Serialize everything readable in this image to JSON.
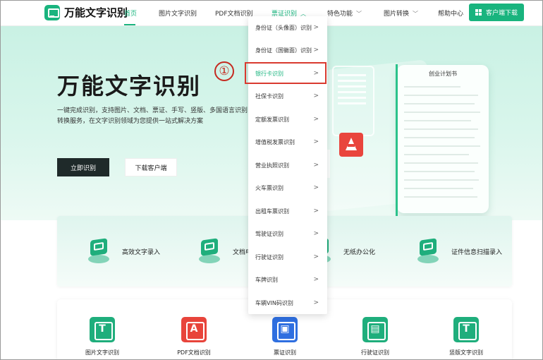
{
  "header": {
    "logo_text": "万能文字识别",
    "nav": [
      {
        "label": "首页"
      },
      {
        "label": "图片文字识别"
      },
      {
        "label": "PDF文档识别"
      },
      {
        "label": "票证识别"
      },
      {
        "label": "特色功能"
      },
      {
        "label": "图片转换"
      },
      {
        "label": "帮助中心"
      }
    ],
    "download_button": "客户端下载"
  },
  "hero": {
    "title": "万能文字识别",
    "description": "一键完成识别，支持图片、文档、票证、手写、竖版、多国语言识别转换服务，在文字识别领域为您提供一站式解决方案",
    "primary_button": "立即识别",
    "secondary_button": "下载客户端",
    "illustration_doc_title": "创业计划书"
  },
  "dropdown": {
    "items": [
      {
        "label": "身份证（头像面）识别"
      },
      {
        "label": "身份证（国徽面）识别"
      },
      {
        "label": "银行卡识别"
      },
      {
        "label": "社保卡识别"
      },
      {
        "label": "定额发票识别"
      },
      {
        "label": "增值税发票识别"
      },
      {
        "label": "营业执照识别"
      },
      {
        "label": "火车票识别"
      },
      {
        "label": "出租车票识别"
      },
      {
        "label": "驾驶证识别"
      },
      {
        "label": "行驶证识别"
      },
      {
        "label": "车牌识别"
      },
      {
        "label": "车辆VIN码识别"
      }
    ],
    "arrow": ">"
  },
  "annotation": {
    "number": "①"
  },
  "features": [
    {
      "label": "高效文字录入"
    },
    {
      "label": "文档电"
    },
    {
      "label": "无纸办公化"
    },
    {
      "label": "证件信息扫描录入"
    }
  ],
  "tools": [
    {
      "label": "图片文字识别",
      "glyph": "T",
      "color": "green"
    },
    {
      "label": "PDF文档识别",
      "glyph": "A",
      "color": "red"
    },
    {
      "label": "票证识别",
      "glyph": "▣",
      "color": "blue"
    },
    {
      "label": "行驶证识别",
      "glyph": "▤",
      "color": "green"
    },
    {
      "label": "竖版文字识别",
      "glyph": "T",
      "color": "green"
    }
  ],
  "colors": {
    "brand": "#19b47e",
    "highlight": "#d93a2f"
  }
}
